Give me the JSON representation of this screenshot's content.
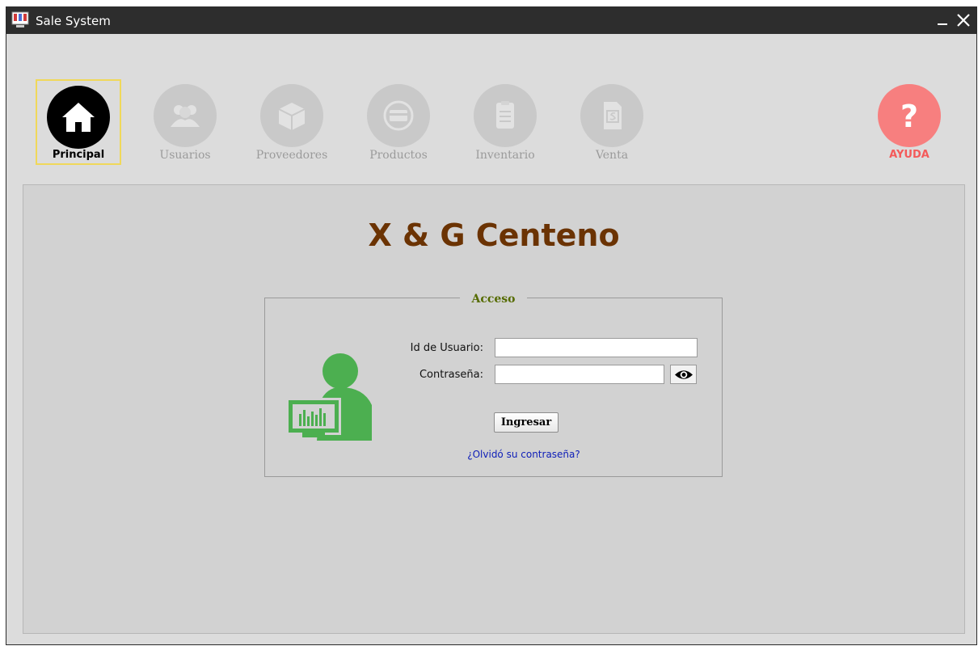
{
  "window": {
    "title": "Sale System",
    "minimize_glyph": "_",
    "close_glyph": "✕"
  },
  "nav": {
    "items": [
      {
        "label": "Principal",
        "icon": "home-icon",
        "active": true
      },
      {
        "label": "Usuarios",
        "icon": "users-icon",
        "active": false
      },
      {
        "label": "Proveedores",
        "icon": "box-icon",
        "active": false
      },
      {
        "label": "Productos",
        "icon": "card-icon",
        "active": false
      },
      {
        "label": "Inventario",
        "icon": "clipboard-icon",
        "active": false
      },
      {
        "label": "Venta",
        "icon": "invoice-icon",
        "active": false
      }
    ],
    "help": {
      "label": "AYUDA",
      "icon": "question-icon",
      "glyph": "?"
    }
  },
  "main": {
    "brand": "X & G Centeno",
    "access": {
      "legend": "Acceso",
      "user_label": "Id de Usuario:",
      "user_value": "",
      "password_label": "Contraseña:",
      "password_value": "",
      "login_button": "Ingresar",
      "forgot_link": "¿Olvidó su contraseña?"
    }
  },
  "colors": {
    "titlebar": "#2d2d2d",
    "brand": "#6b3303",
    "legend": "#556b00",
    "help": "#f45a5a",
    "illustration": "#4caf50",
    "link": "#1020b8"
  }
}
